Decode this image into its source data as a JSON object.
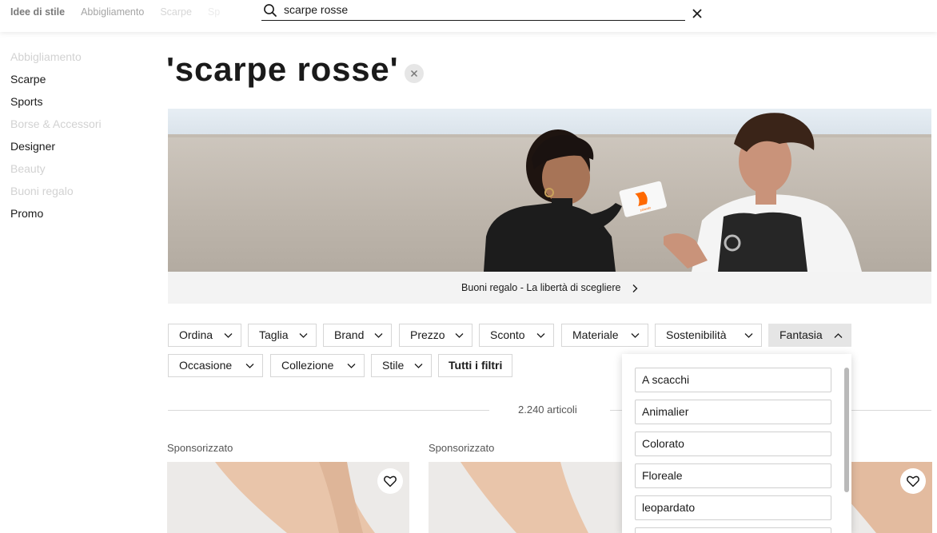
{
  "topnav": {
    "items": [
      "Idee di stile",
      "Abbigliamento",
      "Scarpe",
      "Sp"
    ]
  },
  "search": {
    "value": "scarpe rosse"
  },
  "sidebar": {
    "items": [
      "Abbigliamento",
      "Scarpe",
      "Sports",
      "Borse & Accessori",
      "Designer",
      "Beauty",
      "Buoni regalo",
      "Promo"
    ]
  },
  "page": {
    "title": "'scarpe rosse'"
  },
  "banner": {
    "caption": "Buoni regalo - La libertà di scegliere",
    "card_text": "zalando"
  },
  "filters": {
    "row1": [
      "Ordina",
      "Taglia",
      "Brand",
      "Prezzo",
      "Sconto",
      "Materiale",
      "Sostenibilità",
      "Fantasia"
    ],
    "row2": [
      "Occasione",
      "Collezione",
      "Stile"
    ],
    "all_label": "Tutti i filtri"
  },
  "results": {
    "count": "2.240 articoli",
    "sponsored_label": "Sponsorizzato"
  },
  "dropdown": {
    "options": [
      "A scacchi",
      "Animalier",
      "Colorato",
      "Floreale",
      "leopardato"
    ]
  },
  "colors": {
    "text": "#1a1a1a",
    "muted_nav": "#d2d2d2",
    "active_filter": "#e5e5e5",
    "banner_bg": "#f3f3f3",
    "brand_orange": "#ff6900"
  }
}
